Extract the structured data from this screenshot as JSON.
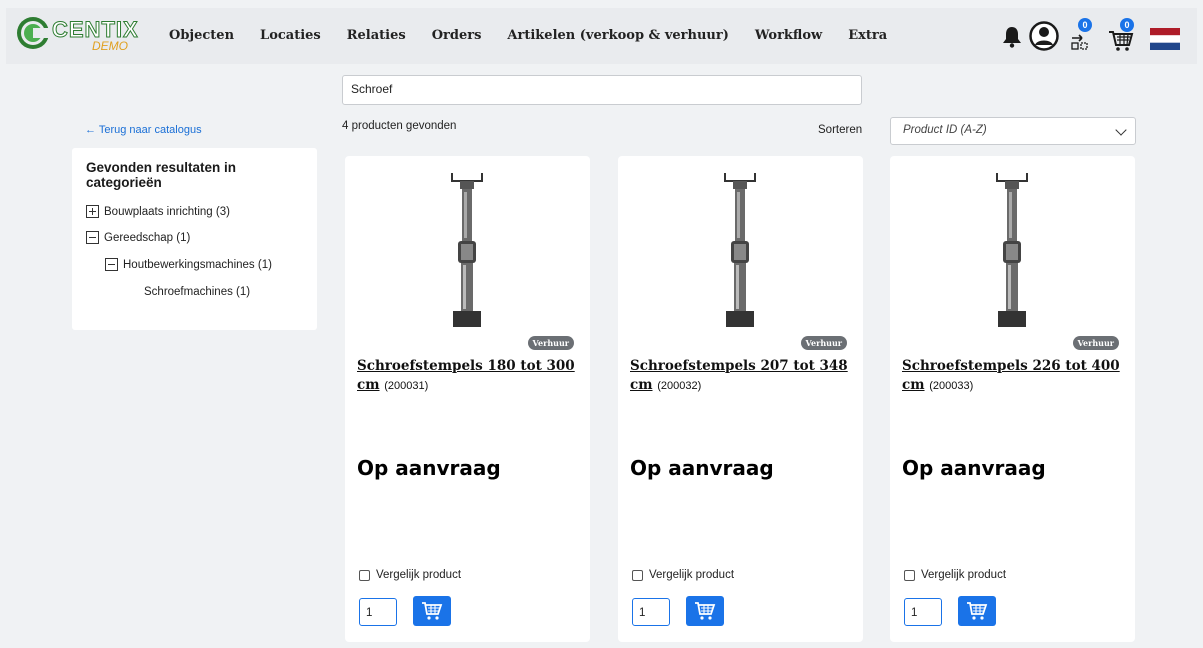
{
  "header": {
    "logo_text": "CENTIX",
    "logo_subtext": "DEMO",
    "nav": [
      "Objecten",
      "Locaties",
      "Relaties",
      "Orders",
      "Artikelen (verkoop & verhuur)",
      "Workflow",
      "Extra"
    ],
    "compare_count": "0",
    "cart_count": "0",
    "icons": [
      "bell-icon",
      "user-avatar-icon",
      "compare-icon",
      "cart-icon",
      "flag-nl-icon"
    ]
  },
  "search": {
    "value": "Schroef"
  },
  "sidebar": {
    "back_link": "← Terug naar catalogus",
    "title": "Gevonden resultaten in categorieën",
    "categories": [
      {
        "label": "Bouwplaats inrichting (3)",
        "state": "collapsed"
      },
      {
        "label": "Gereedschap (1)",
        "state": "expanded"
      },
      {
        "label": "Houtbewerkingsmachines (1)",
        "state": "expanded"
      },
      {
        "label": "Schroefmachines (1)",
        "state": "leaf"
      }
    ]
  },
  "results": {
    "count_text": "4 producten gevonden",
    "sort_label": "Sorteren",
    "sort_value": "Product ID (A-Z)"
  },
  "products": [
    {
      "tag": "Verhuur",
      "name": "Schroefstempels 180 tot 300 cm",
      "id": "(200031)",
      "price": "Op aanvraag",
      "compare_label": "Vergelijk product",
      "qty": "1"
    },
    {
      "tag": "Verhuur",
      "name": "Schroefstempels 207 tot 348 cm",
      "id": "(200032)",
      "price": "Op aanvraag",
      "compare_label": "Vergelijk product",
      "qty": "1"
    },
    {
      "tag": "Verhuur",
      "name": "Schroefstempels 226 tot 400 cm",
      "id": "(200033)",
      "price": "Op aanvraag",
      "compare_label": "Vergelijk product",
      "qty": "1"
    }
  ],
  "colors": {
    "accent": "#1a73e8",
    "link": "#1a6fd6",
    "tag": "#6b6f74",
    "logo_green": "#2e7d32",
    "logo_demo": "#e0a020"
  }
}
